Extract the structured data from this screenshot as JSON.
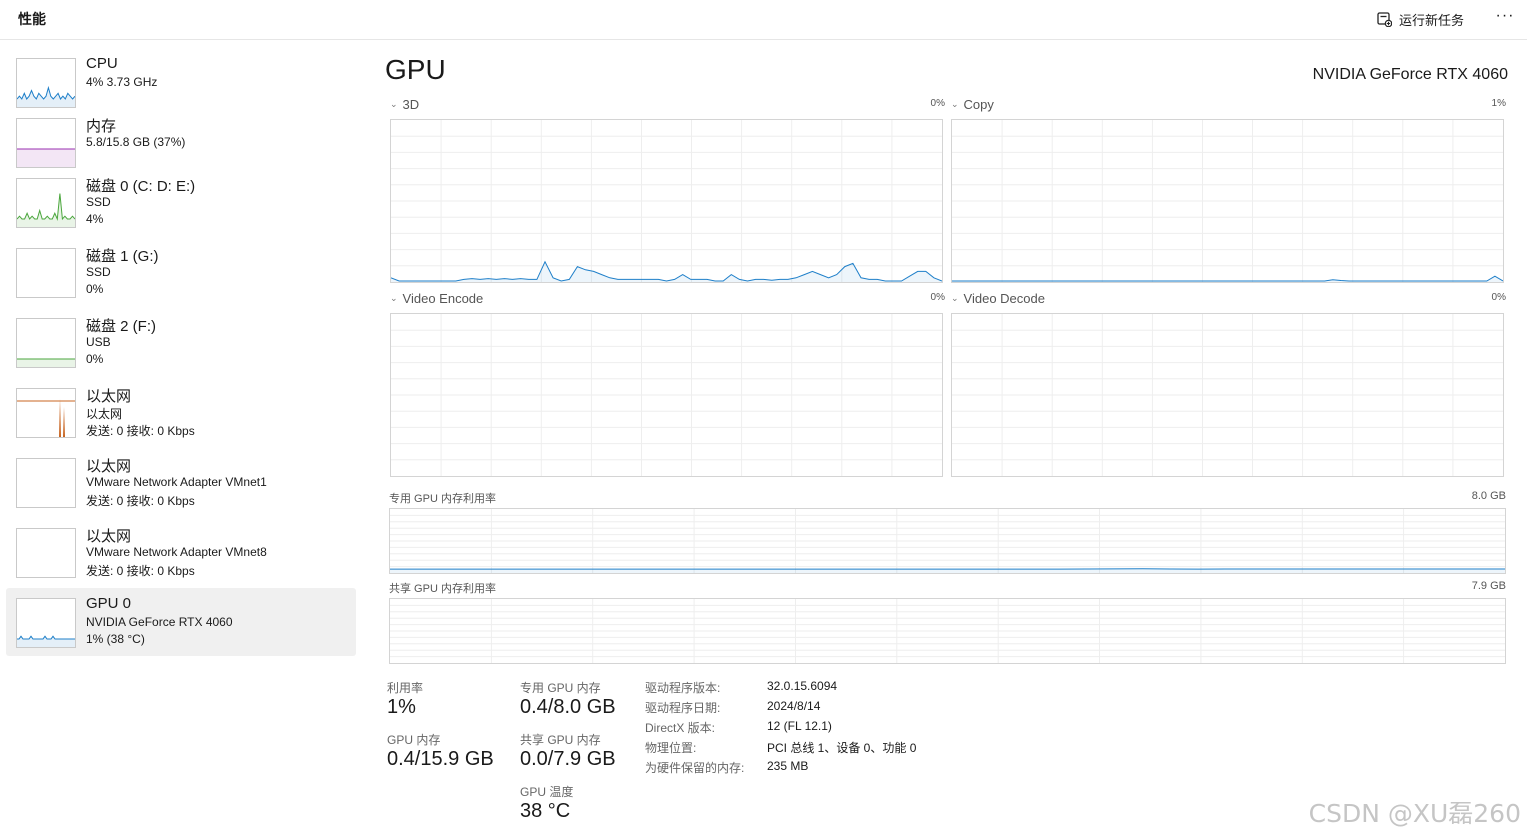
{
  "header": {
    "title": "性能",
    "run_task_label": "运行新任务",
    "more_label": "···"
  },
  "sidebar": {
    "items": [
      {
        "name": "CPU",
        "line2": "4% 3.73 GHz",
        "line3": "",
        "color": "#1e7fc9",
        "selected": false
      },
      {
        "name": "内存",
        "line2": "5.8/15.8 GB (37%)",
        "line3": "",
        "color": "#9a2fb0",
        "selected": false
      },
      {
        "name": "磁盘 0 (C: D: E:)",
        "line2": "SSD",
        "line3": "4%",
        "color": "#4aa63c",
        "selected": false
      },
      {
        "name": "磁盘 1 (G:)",
        "line2": "SSD",
        "line3": "0%",
        "color": "#4aa63c",
        "selected": false
      },
      {
        "name": "磁盘 2 (F:)",
        "line2": "USB",
        "line3": "0%",
        "color": "#4aa63c",
        "selected": false
      },
      {
        "name": "以太网",
        "line2": "以太网",
        "line3": "发送: 0 接收: 0 Kbps",
        "color": "#c86420",
        "selected": false
      },
      {
        "name": "以太网",
        "line2": "VMware Network Adapter VMnet1",
        "line3": "发送: 0 接收: 0 Kbps",
        "color": "#c86420",
        "selected": false
      },
      {
        "name": "以太网",
        "line2": "VMware Network Adapter VMnet8",
        "line3": "发送: 0 接收: 0 Kbps",
        "color": "#c86420",
        "selected": false
      },
      {
        "name": "GPU 0",
        "line2": "NVIDIA GeForce RTX 4060",
        "line3": "1% (38 °C)",
        "color": "#1e7fc9",
        "selected": true
      }
    ]
  },
  "main": {
    "title": "GPU",
    "gpu_model": "NVIDIA GeForce RTX 4060"
  },
  "engines": [
    {
      "label": "3D",
      "percent": "0%"
    },
    {
      "label": "Copy",
      "percent": "1%"
    },
    {
      "label": "Video Encode",
      "percent": "0%"
    },
    {
      "label": "Video Decode",
      "percent": "0%"
    }
  ],
  "memory_graphs": {
    "dedicated_label": "专用 GPU 内存利用率",
    "dedicated_max": "8.0 GB",
    "shared_label": "共享 GPU 内存利用率",
    "shared_max": "7.9 GB"
  },
  "stats": {
    "utilization_label": "利用率",
    "utilization_value": "1%",
    "dedicated_mem_label": "专用 GPU 内存",
    "dedicated_mem_value": "0.4/8.0 GB",
    "gpu_mem_label": "GPU 内存",
    "gpu_mem_value": "0.4/15.9 GB",
    "shared_mem_label": "共享 GPU 内存",
    "shared_mem_value": "0.0/7.9 GB",
    "temp_label": "GPU 温度",
    "temp_value": "38 °C"
  },
  "info": [
    {
      "key": "驱动程序版本:",
      "value": "32.0.15.6094"
    },
    {
      "key": "驱动程序日期:",
      "value": "2024/8/14"
    },
    {
      "key": "DirectX 版本:",
      "value": "12 (FL 12.1)"
    },
    {
      "key": "物理位置:",
      "value": "PCI 总线 1、设备 0、功能 0"
    },
    {
      "key": "为硬件保留的内存:",
      "value": "235 MB"
    }
  ],
  "graph_data": {
    "engine_3d": [
      2,
      0,
      0,
      0,
      0,
      0,
      0,
      0,
      0,
      1,
      1.5,
      1,
      1.5,
      1,
      1.5,
      1,
      1.5,
      1,
      1,
      12,
      2,
      0,
      1,
      9,
      7,
      6,
      4,
      2,
      1,
      1,
      1,
      1,
      1,
      1,
      0,
      1,
      4,
      1,
      1,
      1,
      0,
      0,
      4,
      1,
      0,
      1,
      1,
      0.5,
      1,
      1,
      2,
      4,
      6,
      4,
      2,
      4,
      9,
      11,
      2,
      1,
      1,
      0,
      0,
      0,
      3,
      6,
      6,
      2,
      0
    ],
    "engine_copy": [
      0,
      0,
      0,
      0,
      0,
      0,
      0,
      0,
      0,
      0,
      0,
      0,
      0,
      0,
      0,
      0,
      0,
      0,
      0,
      0,
      0,
      0,
      0,
      0,
      0,
      0,
      0,
      0,
      0,
      0,
      0,
      0,
      0,
      0,
      0,
      0,
      0,
      0,
      0,
      0,
      0,
      0,
      0,
      0,
      0,
      0,
      0,
      0.8,
      0.3,
      0,
      0,
      0,
      0,
      0,
      0,
      0,
      0,
      0,
      0,
      0,
      0,
      0,
      0,
      0,
      0,
      0,
      0,
      3,
      0
    ],
    "engine_video_encode": [],
    "engine_video_decode": [],
    "dedicated_memory": [
      4.6,
      4.6,
      4.6,
      4.6,
      4.6,
      4.6,
      4.6,
      4.6,
      4.6,
      4.6,
      4.6,
      4.6,
      4.6,
      4.6,
      4.6,
      4.6,
      4.6,
      4.6,
      4.6,
      4.6,
      4.6,
      4.6,
      4.6,
      4.6,
      4.7,
      4.8,
      5.0,
      5.4,
      4.9,
      4.7,
      4.8,
      4.8,
      4.8,
      4.9,
      4.8,
      4.8,
      4.8,
      4.8,
      4.8,
      4.8,
      4.8
    ],
    "shared_memory": [
      0,
      0,
      0,
      0,
      0,
      0,
      0,
      0,
      0,
      0
    ]
  }
}
